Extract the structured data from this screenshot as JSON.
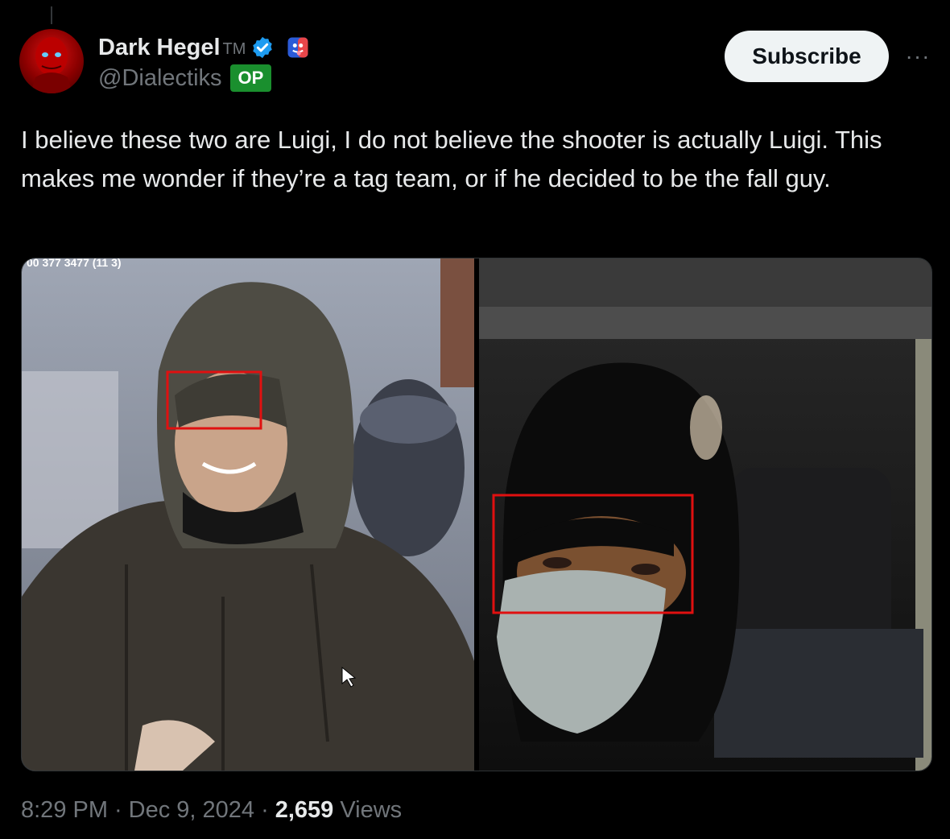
{
  "author": {
    "display_name": "Dark Hegel",
    "tm": "TM",
    "handle": "@Dialectiks",
    "op_badge": "OP",
    "verified_icon": "verified-check-icon",
    "badge_icon": "tongue-face-emoji-icon"
  },
  "actions": {
    "subscribe_label": "Subscribe",
    "more_label": "···"
  },
  "tweet": {
    "text": "I believe these two are Luigi, I do not believe the shooter is actually Luigi. This makes me wonder if they’re a tag team, or if he decided to be the fall guy."
  },
  "media": {
    "left_caption": "00 377 3477 (11 3)",
    "left_description": "hooded-man-smiling-surveillance-photo",
    "right_description": "masked-man-in-car-surveillance-photo"
  },
  "meta": {
    "time": "8:29 PM",
    "dot": "·",
    "date": "Dec 9, 2024",
    "views_count": "2,659",
    "views_label": "Views"
  },
  "colors": {
    "background": "#000000",
    "text": "#e7e9ea",
    "muted": "#71767b",
    "verified_blue": "#1d9bf0",
    "op_green": "#1a8f2e",
    "highlight_red": "#e01010"
  }
}
